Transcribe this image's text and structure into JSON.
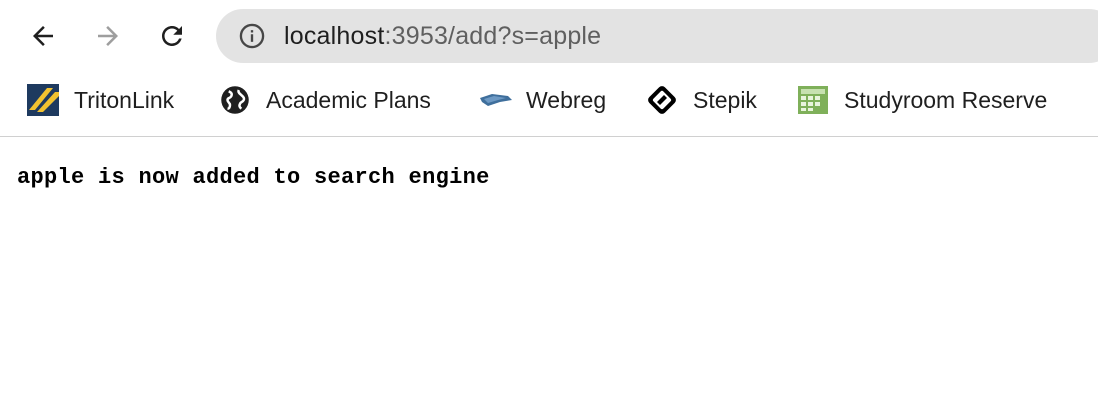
{
  "toolbar": {
    "back_icon": "arrow-left-icon",
    "forward_icon": "arrow-right-icon",
    "reload_icon": "reload-icon"
  },
  "omnibox": {
    "icon": "info-icon",
    "url_host": "localhost",
    "url_rest": ":3953/add?s=apple"
  },
  "bookmarks": [
    {
      "label": "TritonLink",
      "icon": "tritonlink-icon"
    },
    {
      "label": "Academic Plans",
      "icon": "globe-icon"
    },
    {
      "label": "Webreg",
      "icon": "webreg-icon"
    },
    {
      "label": "Stepik",
      "icon": "stepik-icon"
    },
    {
      "label": "Studyroom Reserve",
      "icon": "calendar-icon"
    }
  ],
  "page": {
    "message": "apple is now added to search engine"
  },
  "colors": {
    "omnibox_bg": "#e3e3e3",
    "disabled_icon": "#9e9e9e",
    "text": "#1f1f1f"
  }
}
